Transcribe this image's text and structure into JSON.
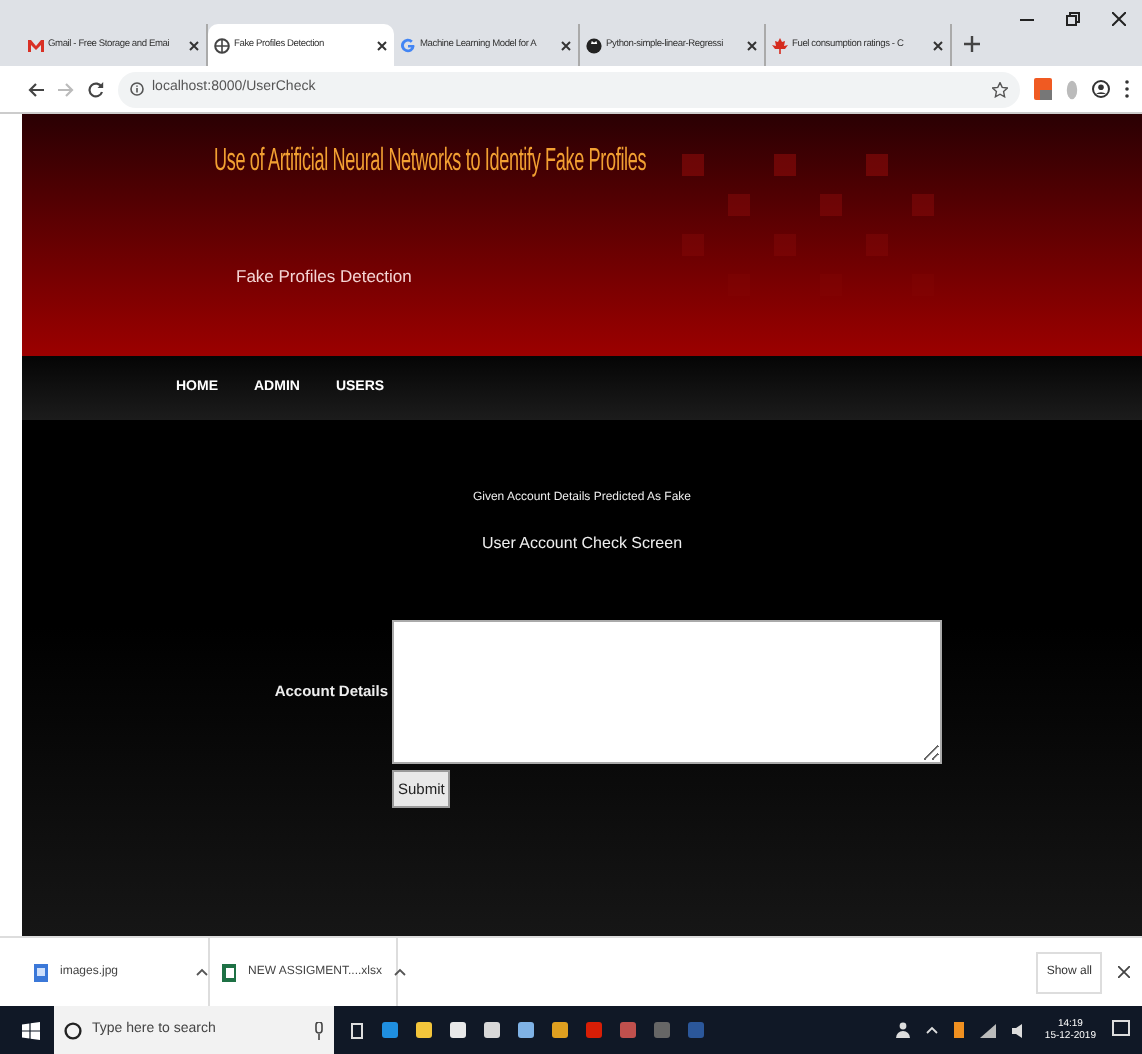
{
  "browser": {
    "tabs": [
      {
        "title": "Gmail - Free Storage and Emai",
        "selected": false
      },
      {
        "title": "Fake Profiles Detection",
        "selected": true
      },
      {
        "title": "Machine Learning Model for A",
        "selected": false
      },
      {
        "title": "Python-simple-linear-Regressi",
        "selected": false
      },
      {
        "title": "Fuel consumption ratings - C",
        "selected": false
      }
    ],
    "address": "localhost:8000/UserCheck"
  },
  "header": {
    "title": "Use of Artificial Neural Networks to Identify Fake Profiles",
    "subtitle": "Fake Profiles Detection"
  },
  "nav": [
    {
      "label": "HOME"
    },
    {
      "label": "ADMIN"
    },
    {
      "label": "USERS"
    }
  ],
  "main": {
    "message": "Given Account Details Predicted As Fake",
    "heading": "User Account Check Screen",
    "field_label": "Account Details",
    "submit": "Submit"
  },
  "downloads": {
    "items": [
      {
        "name": "images.jpg",
        "kind": "image"
      },
      {
        "name": "NEW ASSIGMENT....xlsx",
        "kind": "sheet"
      }
    ],
    "show_all": "Show all"
  },
  "taskbar": {
    "search_placeholder": "Type here to search",
    "time": "14:19",
    "date": "15-12-2019"
  }
}
